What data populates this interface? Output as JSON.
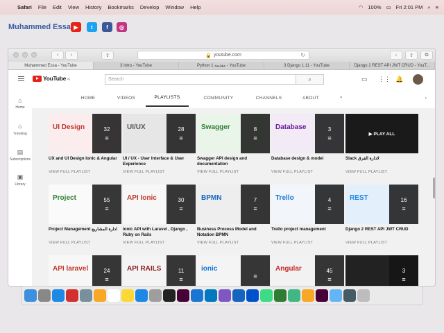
{
  "menubar": {
    "items": [
      "Safari",
      "File",
      "Edit",
      "View",
      "History",
      "Bookmarks",
      "Develop",
      "Window",
      "Help"
    ],
    "battery": "100%",
    "clock": "Fri 2:01 PM"
  },
  "brand": {
    "name": "Muhammed Essa"
  },
  "browser": {
    "url": "youtube.com",
    "tabs": [
      "Muhammed Essa - YouTube",
      "3 Intro - YouTube",
      "Python 1 مقدمة - YouTube",
      "3 Django 1.11 - YouTube",
      "Django 2 REST API JWT CRUD - YouT..."
    ]
  },
  "youtube": {
    "logo_text": "YouTube",
    "logo_sup": "IQ",
    "search_placeholder": "Search",
    "sidebar": [
      {
        "label": "Home",
        "icon": "home-icon"
      },
      {
        "label": "Trending",
        "icon": "trending-icon"
      },
      {
        "label": "Subscriptions",
        "icon": "subscriptions-icon"
      },
      {
        "label": "Library",
        "icon": "library-icon"
      }
    ],
    "channel_tabs": [
      "HOME",
      "VIDEOS",
      "PLAYLISTS",
      "COMMUNITY",
      "CHANNELS",
      "ABOUT"
    ],
    "active_tab": "PLAYLISTS",
    "view_full": "VIEW FULL PLAYLIST",
    "play_all": "▶ PLAY ALL",
    "playlists": [
      {
        "title": "UX and UI Design Ionic & Angular",
        "count": "32",
        "thumb": "UI Design",
        "color": "#c0392b",
        "bg": "#fbecee"
      },
      {
        "title": "UI / UX - User Interface & User Experience",
        "count": "28",
        "thumb": "UI/UX",
        "color": "#555555",
        "bg": "#e6e6e6"
      },
      {
        "title": "Swagger API design and documentation",
        "count": "8",
        "thumb": "Swagger",
        "color": "#2e7d32",
        "bg": "#eaf5ea"
      },
      {
        "title": "Database design & model",
        "count": "3",
        "thumb": "Database",
        "color": "#6a1b9a",
        "bg": "#f2eaf5"
      },
      {
        "title": "Slack لادارة الفرق",
        "count": "",
        "thumb": "",
        "color": "#ffffff",
        "bg": "#1a1a1a"
      },
      {
        "title": "Project Management ادارة المشاريع",
        "count": "55",
        "thumb": "Project",
        "color": "#2e7d32",
        "bg": "#fafafa"
      },
      {
        "title": "Ionic API with Laravel , Django , Ruby on Rails",
        "count": "30",
        "thumb": "API Ionic",
        "color": "#c0392b",
        "bg": "#f7f7f7"
      },
      {
        "title": "Business Process Model and Notation BPMN",
        "count": "7",
        "thumb": "BPMN",
        "color": "#1565c0",
        "bg": "#eeeeee"
      },
      {
        "title": "Trello project management",
        "count": "4",
        "thumb": "Trello",
        "color": "#1976d2",
        "bg": "#f2f6fb"
      },
      {
        "title": "Django 2 REST API JWT CRUD",
        "count": "16",
        "thumb": "REST",
        "color": "#1e88e5",
        "bg": "#e3f0fb"
      },
      {
        "title": "",
        "count": "24",
        "thumb": "API laravel",
        "color": "#c0392b",
        "bg": "#f7f7f7"
      },
      {
        "title": "",
        "count": "11",
        "thumb": "API RAILS",
        "color": "#8b1e1e",
        "bg": "#f4f4f4"
      },
      {
        "title": "",
        "count": "",
        "thumb": "ionic",
        "color": "#1976d2",
        "bg": "#f4f4f4"
      },
      {
        "title": "",
        "count": "45",
        "thumb": "Angular",
        "color": "#c62828",
        "bg": "#f2f2f2"
      },
      {
        "title": "",
        "count": "3",
        "thumb": "",
        "color": "#ffffff",
        "bg": "#222222"
      }
    ]
  }
}
